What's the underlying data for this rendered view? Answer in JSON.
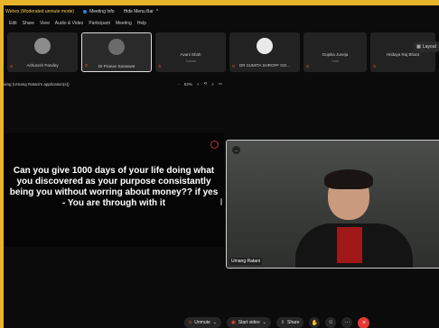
{
  "titlebar": {
    "app_name": "Webex (Moderated unmute mode)",
    "meeting_info": "Meeting Info",
    "hide_menu": "Hide Menu Bar",
    "chevron": "^"
  },
  "menu": [
    "Edit",
    "Share",
    "View",
    "Audio & Video",
    "Participant",
    "Meeting",
    "Help"
  ],
  "participants": [
    {
      "name": "Ashutosh Pandey",
      "subtitle": "",
      "initials": "AP"
    },
    {
      "name": "Dr Pranav Saraswat",
      "subtitle": "",
      "initials": "PS"
    },
    {
      "name": "Avani Shah",
      "subtitle": "Cohost",
      "initials": ""
    },
    {
      "name": "DR SUMITA SHROFF GO...",
      "subtitle": "",
      "initials": "SS"
    },
    {
      "name": "Gopika Juneja",
      "subtitle": "Host",
      "initials": ""
    },
    {
      "name": "Hridaya Raj Bhant",
      "subtitle": "",
      "initials": ""
    }
  ],
  "layout_button": "Layout",
  "share": {
    "label": "aing (Umang Ratani's application(s))",
    "zoom_minus": "-",
    "zoom_value": "53%",
    "zoom_plus": "+"
  },
  "slide": {
    "text": "Can you give 1000 days of your life doing what you discovered as your purpose consistantly being you without worring about money?? if yes - You are through with it"
  },
  "video": {
    "name": "Umang Ratani",
    "options_icon": "..."
  },
  "controls": {
    "unmute": "Unmute",
    "start_video": "Start video",
    "share": "Share",
    "more": "···",
    "leave": "×"
  },
  "colors": {
    "frame": "#e8b52a",
    "leave": "#e53935",
    "muted_icon": "#e74c3c"
  }
}
